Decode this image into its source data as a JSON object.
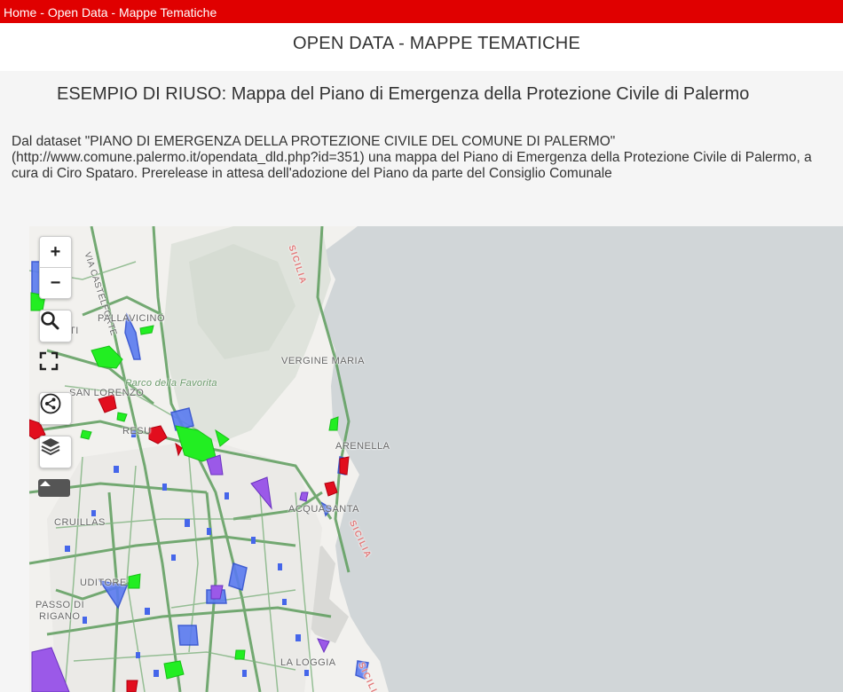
{
  "breadcrumb": {
    "home": "Home",
    "sep1": " - ",
    "open_data": "Open Data",
    "sep2": " - ",
    "current": "Mappe Tematiche"
  },
  "header": {
    "title": "OPEN DATA - MAPPE TEMATICHE"
  },
  "content": {
    "subtitle": "ESEMPIO DI RIUSO: Mappa del Piano di Emergenza della Protezione Civile di Palermo",
    "description": "Dal dataset \"PIANO DI EMERGENZA DELLA PROTEZIONE CIVILE DEL COMUNE DI PALERMO\" (http://www.comune.palermo.it/opendata_dld.php?id=351) una mappa del Piano di Emergenza della Protezione Civile di Palermo, a cura di Ciro Spataro. Prerelease in attesa dell'adozione del Piano da parte del Consiglio Comunale"
  },
  "map": {
    "controls": {
      "zoom_in": "+",
      "zoom_out": "−",
      "icons": [
        "search-icon",
        "fullscreen-icon",
        "share-icon",
        "layers-icon",
        "collapse-arrow-icon"
      ]
    },
    "labels": {
      "castelforte": "VIA CASTELFORTE",
      "pallavicino": "PALLAVICINO",
      "ti": "TI",
      "san_lorenzo": "SAN LORENZO",
      "parco": "Parco della Favorita",
      "resu": "RESU",
      "vergine_maria": "VERGINE MARIA",
      "arenella": "ARENELLA",
      "acquasanta": "ACQUASANTA",
      "cruillas": "CRUILLAS",
      "uditore": "UDITORE",
      "passo_di": "PASSO DI",
      "rigano": "RIGANO",
      "la_loggia": "LA LOGGIA",
      "sicilia": "SICILIA"
    },
    "colors": {
      "sea": "#d1d6d8",
      "land": "#f2f1ee",
      "park": "#dfe3dc",
      "roads": "#5d9d5d",
      "shelter": "#3b5ee6",
      "waiting_area": "#22ee22",
      "danger_area": "#e20e1e",
      "gathering_area": "#8f4ee6"
    }
  }
}
